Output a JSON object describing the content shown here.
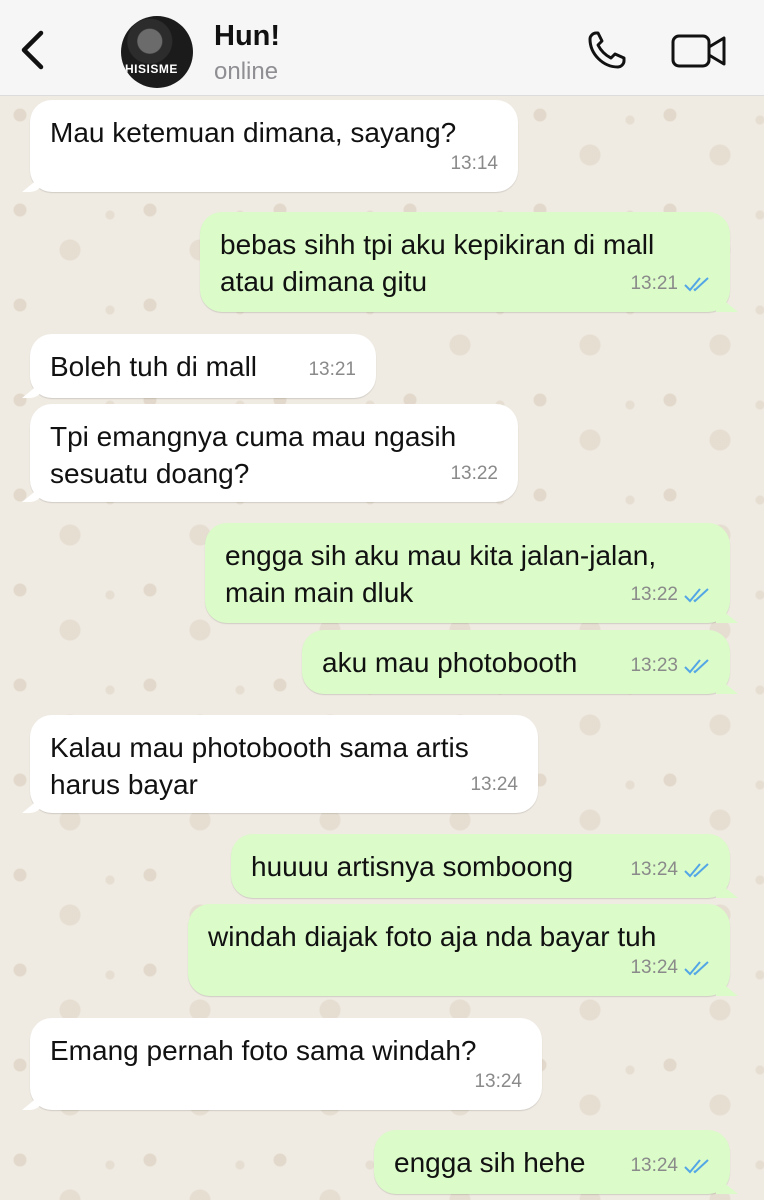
{
  "header": {
    "back_icon": "chevron-left-icon",
    "contact_name": "Hun!",
    "contact_status": "online",
    "avatar_text": "HISISME",
    "call_icon": "phone-icon",
    "video_icon": "video-camera-icon"
  },
  "colors": {
    "incoming_bubble": "#ffffff",
    "outgoing_bubble": "#dbfbc9",
    "read_ticks": "#53a6e6",
    "background": "#efeae2"
  },
  "messages": [
    {
      "dir": "in",
      "lines": [
        "Mau ketemuan dimana, sayang?"
      ],
      "time": "13:14"
    },
    {
      "dir": "out",
      "lines": [
        "bebas sihh tpi aku kepikiran di mall",
        "atau dimana gitu"
      ],
      "time": "13:21",
      "read": true
    },
    {
      "dir": "in",
      "lines": [
        "Boleh tuh di mall"
      ],
      "time": "13:21"
    },
    {
      "dir": "in",
      "lines": [
        "Tpi emangnya cuma mau ngasih",
        "sesuatu doang?"
      ],
      "time": "13:22"
    },
    {
      "dir": "out",
      "lines": [
        "engga sih aku mau kita jalan-jalan,",
        "main main dluk"
      ],
      "time": "13:22",
      "read": true
    },
    {
      "dir": "out",
      "lines": [
        "aku mau photobooth"
      ],
      "time": "13:23",
      "read": true
    },
    {
      "dir": "in",
      "lines": [
        "Kalau mau photobooth sama artis",
        "harus bayar"
      ],
      "time": "13:24"
    },
    {
      "dir": "out",
      "lines": [
        "huuuu artisnya somboong"
      ],
      "time": "13:24",
      "read": true
    },
    {
      "dir": "out",
      "lines": [
        "windah diajak foto aja nda bayar tuh"
      ],
      "time": "13:24",
      "read": true
    },
    {
      "dir": "in",
      "lines": [
        "Emang pernah foto sama windah?"
      ],
      "time": "13:24"
    },
    {
      "dir": "out",
      "lines": [
        "engga sih hehe"
      ],
      "time": "13:24",
      "read": true
    }
  ]
}
